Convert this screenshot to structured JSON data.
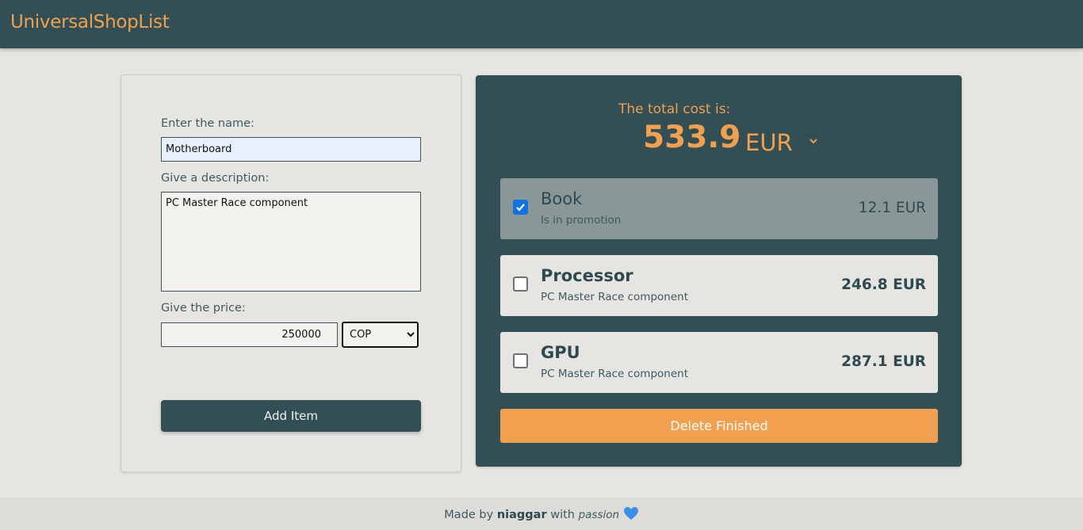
{
  "app": {
    "title": "UniversalShopList"
  },
  "form": {
    "name_label": "Enter the name:",
    "name_value": "Motherboard",
    "desc_label": "Give a description:",
    "desc_value": "PC Master Race component",
    "price_label": "Give the price:",
    "price_value": "250000",
    "currency_selected": "COP",
    "add_button": "Add Item"
  },
  "summary": {
    "total_label": "The total cost is:",
    "total_value": "533.9",
    "currency": "EUR"
  },
  "items": [
    {
      "title": "Book",
      "description": "Is in promotion",
      "price": "12.1 EUR",
      "checked": true
    },
    {
      "title": "Processor",
      "description": "PC Master Race component",
      "price": "246.8 EUR",
      "checked": false
    },
    {
      "title": "GPU",
      "description": "PC Master Race component",
      "price": "287.1 EUR",
      "checked": false
    }
  ],
  "actions": {
    "delete_finished": "Delete Finished"
  },
  "footer": {
    "prefix": "Made by",
    "author": "niaggar",
    "middle": "with",
    "word": "passion"
  },
  "colors": {
    "primary": "#324f55",
    "accent": "#f0a04f",
    "background": "#e7e5e1",
    "heart": "#3a8ee6"
  },
  "icons": {
    "dropdown": "chevron-down-icon",
    "heart": "heart-icon",
    "check": "checkmark-icon"
  }
}
